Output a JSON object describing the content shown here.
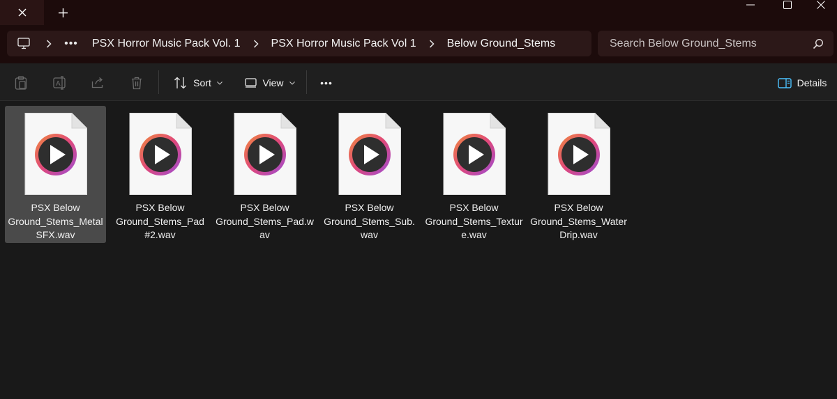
{
  "titlebar": {
    "tab_close_glyph": "✕",
    "new_tab_glyph": "+",
    "window_controls": [
      "minimize",
      "maximize",
      "close"
    ]
  },
  "breadcrumb": {
    "root_icon": "computer-icon",
    "more_label": "•••",
    "items": [
      "PSX Horror Music Pack Vol. 1",
      "PSX Horror Music Pack Vol 1",
      "Below Ground_Stems"
    ]
  },
  "search": {
    "placeholder": "Search Below Ground_Stems"
  },
  "commandbar": {
    "icons": [
      "clipboard-icon",
      "rename-icon",
      "share-icon",
      "delete-icon"
    ],
    "sort_label": "Sort",
    "view_label": "View",
    "more_label": "•••",
    "details_label": "Details"
  },
  "files": [
    {
      "name": "PSX Below Ground_Stems_Metal SFX.wav",
      "lines": [
        "PSX Below",
        "Ground_Stems_Metal",
        "SFX.wav"
      ],
      "selected": true
    },
    {
      "name": "PSX Below Ground_Stems_Pad #2.wav",
      "lines": [
        "PSX Below",
        "Ground_Stems_Pad",
        "#2.wav"
      ],
      "selected": false
    },
    {
      "name": "PSX Below Ground_Stems_Pad.wav",
      "lines": [
        "PSX Below",
        "Ground_Stems_Pad.w",
        "av"
      ],
      "selected": false
    },
    {
      "name": "PSX Below Ground_Stems_Sub.wav",
      "lines": [
        "PSX Below",
        "Ground_Stems_Sub.",
        "wav"
      ],
      "selected": false
    },
    {
      "name": "PSX Below Ground_Stems_Texture.wav",
      "lines": [
        "PSX Below",
        "Ground_Stems_Textur",
        "e.wav"
      ],
      "selected": false
    },
    {
      "name": "PSX Below Ground_Stems_Water Drip.wav",
      "lines": [
        "PSX Below",
        "Ground_Stems_Water",
        "Drip.wav"
      ],
      "selected": false
    }
  ],
  "colors": {
    "titlebar_bg": "#1c0b0b",
    "field_bg": "#2c1818",
    "body_bg": "#191919",
    "selected_tile": "#4a4a4a",
    "accent_blue": "#4cc2ff"
  }
}
